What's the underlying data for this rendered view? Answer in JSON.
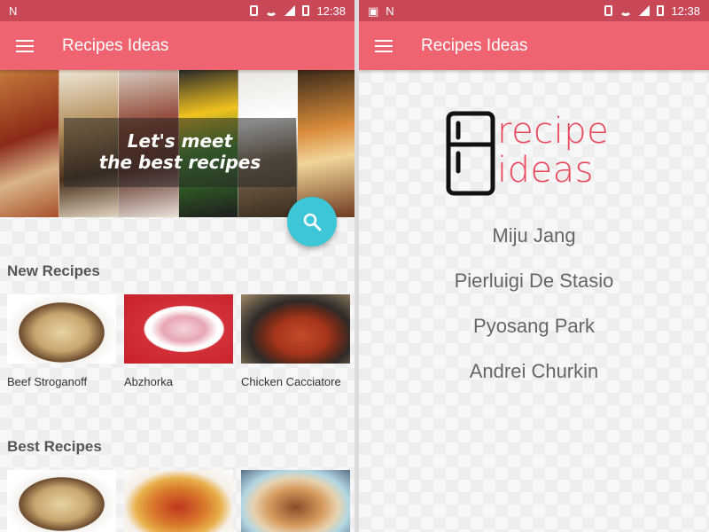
{
  "status": {
    "time_left": "12:38",
    "time_right": "12:38",
    "left_app_icon": "n-logo-icon",
    "image_icon": "image-icon"
  },
  "appbar": {
    "title": "Recipes Ideas",
    "menu_icon": "hamburger-menu-icon",
    "color": "#f06371",
    "status_color": "#c94857"
  },
  "hero": {
    "caption_line1": "Let's meet",
    "caption_line2": "the best recipes"
  },
  "fab": {
    "icon": "search-icon",
    "color": "#3cc6d6"
  },
  "new_recipes": {
    "title": "New Recipes",
    "items": [
      {
        "label": "Beef Stroganoff"
      },
      {
        "label": "Abzhorka"
      },
      {
        "label": "Chicken Cacciatore"
      }
    ]
  },
  "best_recipes": {
    "title": "Best Recipes"
  },
  "about": {
    "logo_line1": "recipe",
    "logo_line2": "ideas",
    "logo_icon": "fridge-icon",
    "authors": [
      "Miju Jang",
      "Pierluigi De Stasio",
      "Pyosang Park",
      "Andrei Churkin"
    ]
  }
}
